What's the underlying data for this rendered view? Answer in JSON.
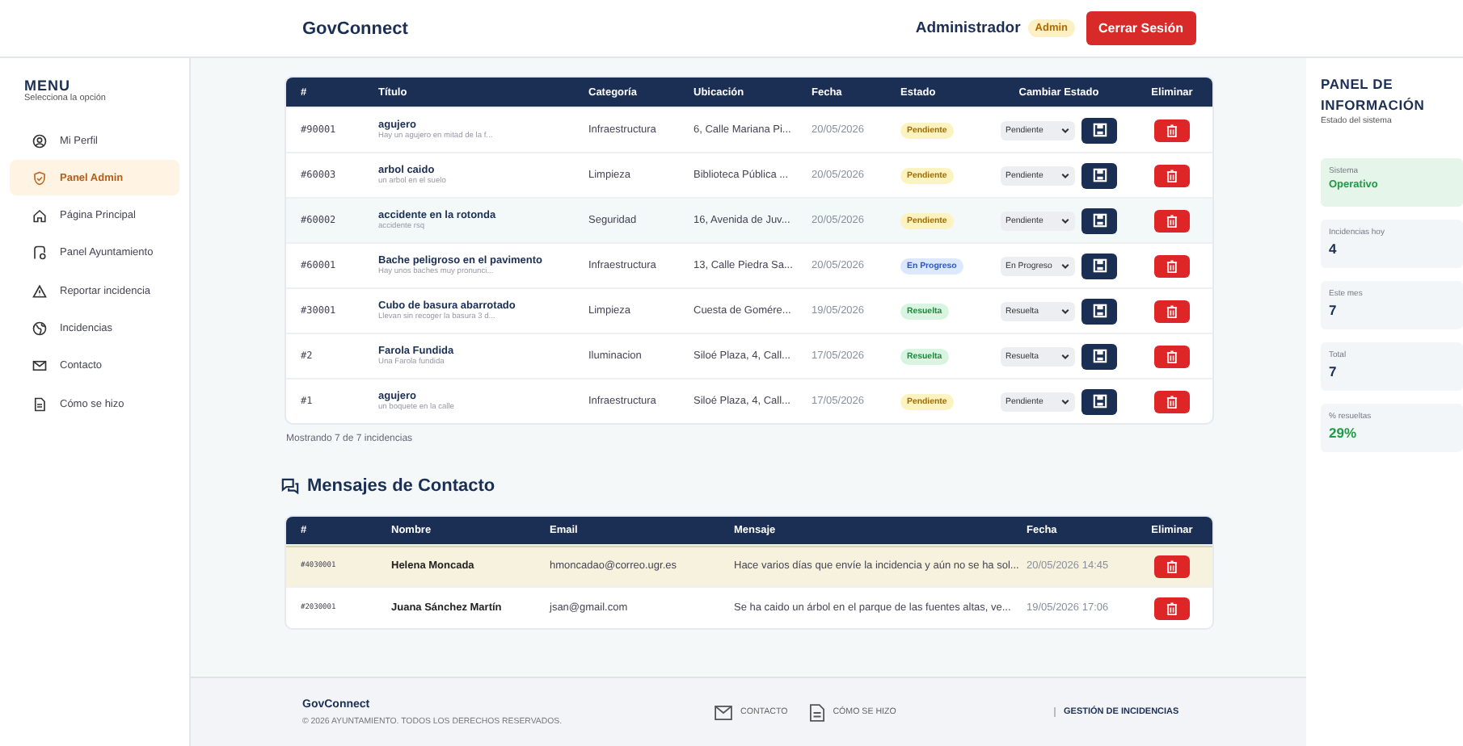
{
  "header": {
    "logo": "GovConnect",
    "user": "Administrador",
    "role_badge": "Admin",
    "logout": "Cerrar Sesión"
  },
  "sidebar": {
    "title": "MENU",
    "subtitle": "Selecciona la opción",
    "items": [
      {
        "label": "Mi Perfil",
        "selected": false
      },
      {
        "label": "Panel Admin",
        "selected": true
      },
      {
        "label": "Página Principal",
        "selected": false
      },
      {
        "label": "Panel Ayuntamiento",
        "selected": false
      },
      {
        "label": "Reportar incidencia",
        "selected": false
      },
      {
        "label": "Incidencias",
        "selected": false
      },
      {
        "label": "Contacto",
        "selected": false
      },
      {
        "label": "Cómo se hizo",
        "selected": false
      }
    ]
  },
  "incidents": {
    "columns": [
      "#",
      "Título",
      "Categoría",
      "Ubicación",
      "Fecha",
      "Estado",
      "Cambiar Estado",
      "Eliminar"
    ],
    "rows": [
      {
        "id": "#90001",
        "title": "agujero",
        "desc": "Hay un agujero en mitad de la f...",
        "category": "Infraestructura",
        "location": "6, Calle Mariana Pi...",
        "date": "20/05/2026",
        "status": {
          "kind": "pending",
          "label": "Pendiente"
        },
        "select": "Pendiente",
        "highlighted": false
      },
      {
        "id": "#60003",
        "title": "arbol caido",
        "desc": "un arbol en el suelo",
        "category": "Limpieza",
        "location": "Biblioteca Pública ...",
        "date": "20/05/2026",
        "status": {
          "kind": "pending",
          "label": "Pendiente"
        },
        "select": "Pendiente",
        "highlighted": false
      },
      {
        "id": "#60002",
        "title": "accidente en la rotonda",
        "desc": "accidente rsq",
        "category": "Seguridad",
        "location": "16, Avenida de Juv...",
        "date": "20/05/2026",
        "status": {
          "kind": "pending",
          "label": "Pendiente"
        },
        "select": "Pendiente",
        "highlighted": true
      },
      {
        "id": "#60001",
        "title": "Bache peligroso en el pavimento",
        "desc": "Hay unos baches muy pronunci...",
        "category": "Infraestructura",
        "location": "13, Calle Piedra Sa...",
        "date": "20/05/2026",
        "status": {
          "kind": "progress",
          "label": "En Progreso"
        },
        "select": "En Progreso",
        "highlighted": false
      },
      {
        "id": "#30001",
        "title": "Cubo de basura abarrotado",
        "desc": "Llevan sin recoger la basura 3 d...",
        "category": "Limpieza",
        "location": "Cuesta de Gomére...",
        "date": "19/05/2026",
        "status": {
          "kind": "resolved",
          "label": "Resuelta"
        },
        "select": "Resuelta",
        "highlighted": false
      },
      {
        "id": "#2",
        "title": "Farola Fundida",
        "desc": "Una Farola fundida",
        "category": "Iluminacion",
        "location": "Siloé Plaza, 4, Call...",
        "date": "17/05/2026",
        "status": {
          "kind": "resolved",
          "label": "Resuelta"
        },
        "select": "Resuelta",
        "highlighted": false
      },
      {
        "id": "#1",
        "title": "agujero",
        "desc": "un boquete en la calle",
        "category": "Infraestructura",
        "location": "Siloé Plaza, 4, Call...",
        "date": "17/05/2026",
        "status": {
          "kind": "pending",
          "label": "Pendiente"
        },
        "select": "Pendiente",
        "highlighted": false
      }
    ],
    "summary": "Mostrando 7 de 7 incidencias"
  },
  "messages": {
    "title": "Mensajes de Contacto",
    "columns": [
      "#",
      "Nombre",
      "Email",
      "Mensaje",
      "Fecha",
      "Eliminar"
    ],
    "rows": [
      {
        "id": "#4030001",
        "name": "Helena Moncada",
        "email": "hmoncadao@correo.ugr.es",
        "message": "Hace varios días que envíe la incidencia y aún no se ha sol...",
        "date": "20/05/2026 14:45",
        "selected": true
      },
      {
        "id": "#2030001",
        "name": "Juana Sánchez Martín",
        "email": "jsan@gmail.com",
        "message": "Se ha caido un árbol en el parque de las fuentes altas, ve...",
        "date": "19/05/2026 17:06",
        "selected": false
      }
    ]
  },
  "info_panel": {
    "title": "PANEL DE INFORMACIÓN",
    "subtitle": "Estado del sistema",
    "stats": [
      {
        "label": "Sistema",
        "value": "Operativo",
        "kind": "ok"
      },
      {
        "label": "Incidencias hoy",
        "value": "4",
        "kind": "plain"
      },
      {
        "label": "Este mes",
        "value": "7",
        "kind": "plain"
      },
      {
        "label": "Total",
        "value": "7",
        "kind": "plain"
      },
      {
        "label": "% resueltas",
        "value": "29%",
        "kind": "good"
      }
    ]
  },
  "footer": {
    "brand": "GovConnect",
    "copyright": "© 2026 AYUNTAMIENTO. TODOS LOS DERECHOS RESERVADOS.",
    "links": [
      "CONTACTO",
      "CÓMO SE HIZO"
    ],
    "section": "GESTIÓN DE INCIDENCIAS"
  }
}
